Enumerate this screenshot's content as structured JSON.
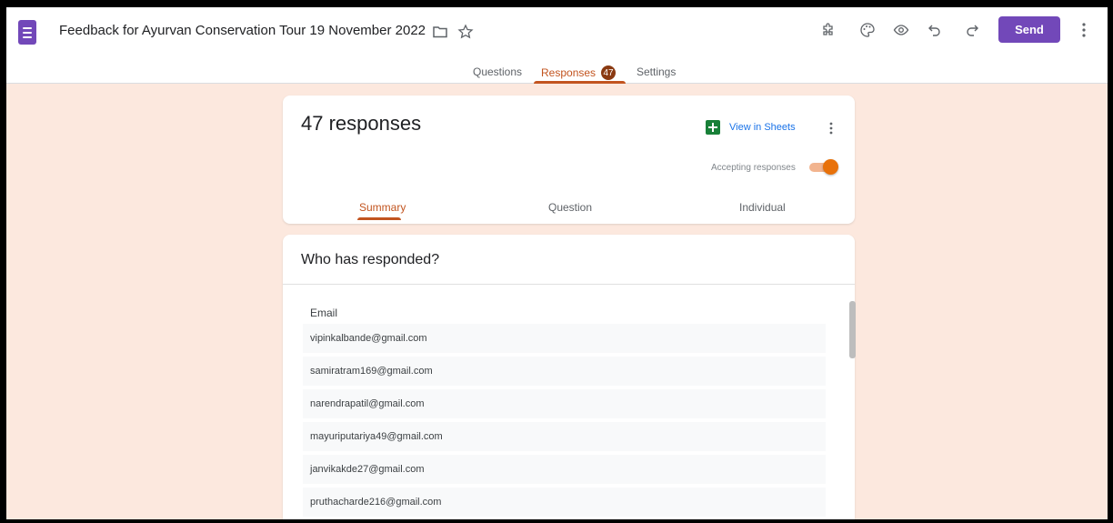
{
  "header": {
    "title": "Feedback for Ayurvan Conservation Tour 19 November 2022",
    "send_label": "Send",
    "icons": [
      "folder-icon",
      "star-icon",
      "addons-icon",
      "palette-icon",
      "preview-eye-icon",
      "undo-icon",
      "redo-icon",
      "more-vert-icon"
    ],
    "accent_color": "#7248b9"
  },
  "tabs": [
    {
      "label": "Questions"
    },
    {
      "label": "Responses",
      "badge": "47"
    },
    {
      "label": "Settings"
    }
  ],
  "summary_card": {
    "count_label": "47 responses",
    "sheets_label": "View in Sheets",
    "accepting_label": "Accepting responses",
    "accepting": true,
    "subtabs": [
      "Summary",
      "Question",
      "Individual"
    ]
  },
  "responders_card": {
    "heading": "Who has responded?",
    "column_header": "Email",
    "emails": [
      "vipinkalbande@gmail.com",
      "samiratram169@gmail.com",
      "narendrapatil@gmail.com",
      "mayuriputariya49@gmail.com",
      "janvikakde27@gmail.com",
      "pruthacharde216@gmail.com"
    ]
  },
  "colors": {
    "theme_background": "#fce8de",
    "theme_accent": "#c2541f",
    "toggle_on": "#e8710a",
    "sheets_green": "#188038"
  }
}
